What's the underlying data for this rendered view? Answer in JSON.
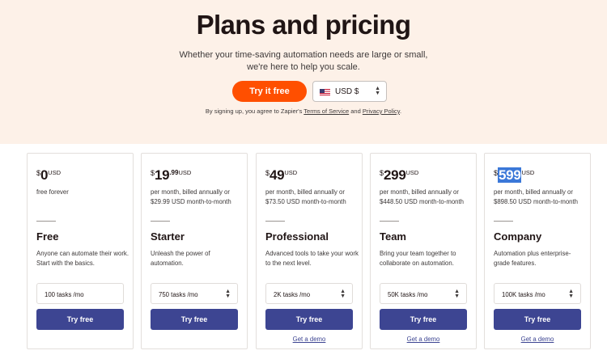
{
  "hero": {
    "title": "Plans and pricing",
    "subtitle_line1": "Whether your time-saving automation needs are large or small,",
    "subtitle_line2": "we're here to help you scale.",
    "cta_label": "Try it free",
    "currency": "USD $",
    "legal_prefix": "By signing up, you agree to Zapier's",
    "terms_link": "Terms of Service",
    "legal_and": "and",
    "privacy_link": "Privacy Policy",
    "legal_suffix": "."
  },
  "plans": [
    {
      "dollar": "$",
      "amount": "0",
      "cents": "",
      "usd": "USD",
      "billing": "free forever",
      "name": "Free",
      "desc": "Anyone can automate their work. Start with the basics.",
      "tasks": "100 tasks /mo",
      "has_stepper": false,
      "button": "Try free",
      "demo": ""
    },
    {
      "dollar": "$",
      "amount": "19",
      "cents": ".99",
      "usd": "USD",
      "billing": "per month, billed annually or $29.99 USD month-to-month",
      "name": "Starter",
      "desc": "Unleash the power of automation.",
      "tasks": "750 tasks /mo",
      "has_stepper": true,
      "button": "Try free",
      "demo": ""
    },
    {
      "dollar": "$",
      "amount": "49",
      "cents": "",
      "usd": "USD",
      "billing": "per month, billed annually or $73.50 USD month-to-month",
      "name": "Professional",
      "desc": "Advanced tools to take your work to the next level.",
      "tasks": "2K tasks /mo",
      "has_stepper": true,
      "button": "Try free",
      "demo": "Get a demo"
    },
    {
      "dollar": "$",
      "amount": "299",
      "cents": "",
      "usd": "USD",
      "billing": "per month, billed annually or $448.50 USD month-to-month",
      "name": "Team",
      "desc": "Bring your team together to collaborate on automation.",
      "tasks": "50K tasks /mo",
      "has_stepper": true,
      "button": "Try free",
      "demo": "Get a demo"
    },
    {
      "dollar": "$",
      "amount": "599",
      "cents": "",
      "usd": "USD",
      "billing": "per month, billed annually or $898.50 USD month-to-month",
      "name": "Company",
      "desc": "Automation plus enterprise-grade features.",
      "tasks": "100K tasks /mo",
      "has_stepper": true,
      "button": "Try free",
      "demo": "Get a demo",
      "amount_highlighted": true
    }
  ],
  "colors": {
    "hero_bg": "#fdf1e8",
    "accent_orange": "#ff4f00",
    "button_navy": "#3d4592",
    "selection_blue": "#3b78d8"
  },
  "icons": {
    "currency_flag": "us-flag-icon",
    "stepper": "chevron-up-down-icon"
  }
}
